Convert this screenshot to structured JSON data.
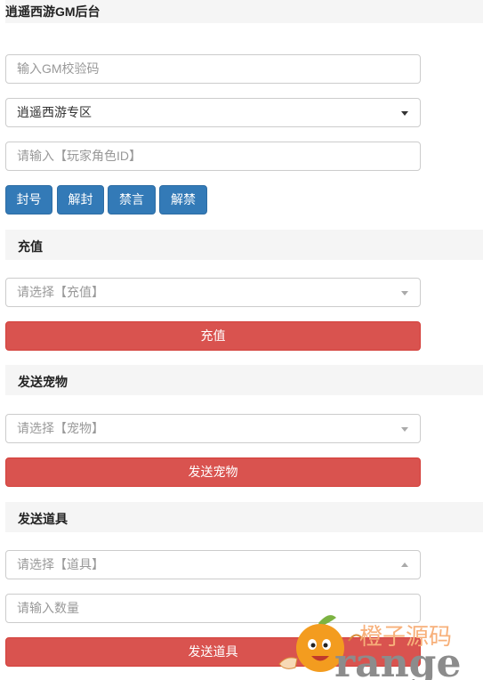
{
  "header": {
    "title": "逍遥西游GM后台"
  },
  "form": {
    "gm_code_placeholder": "输入GM校验码",
    "zone_select_value": "逍遥西游专区",
    "role_id_placeholder": "请输入【玩家角色ID】"
  },
  "actions": {
    "ban_label": "封号",
    "unban_label": "解封",
    "mute_label": "禁言",
    "unmute_label": "解禁"
  },
  "recharge": {
    "title": "充值",
    "select_placeholder": "请选择【充值】",
    "button_label": "充值"
  },
  "pet": {
    "title": "发送宠物",
    "select_placeholder": "请选择【宠物】",
    "button_label": "发送宠物"
  },
  "item": {
    "title": "发送道具",
    "select_placeholder": "请选择【道具】",
    "quantity_placeholder": "请输入数量",
    "button_label": "发送道具"
  },
  "watermark": {
    "text_cn": "橙子源码",
    "text_en": "range"
  },
  "colors": {
    "primary": "#337ab7",
    "danger": "#d9534f",
    "header_bg": "#f5f5f5"
  }
}
